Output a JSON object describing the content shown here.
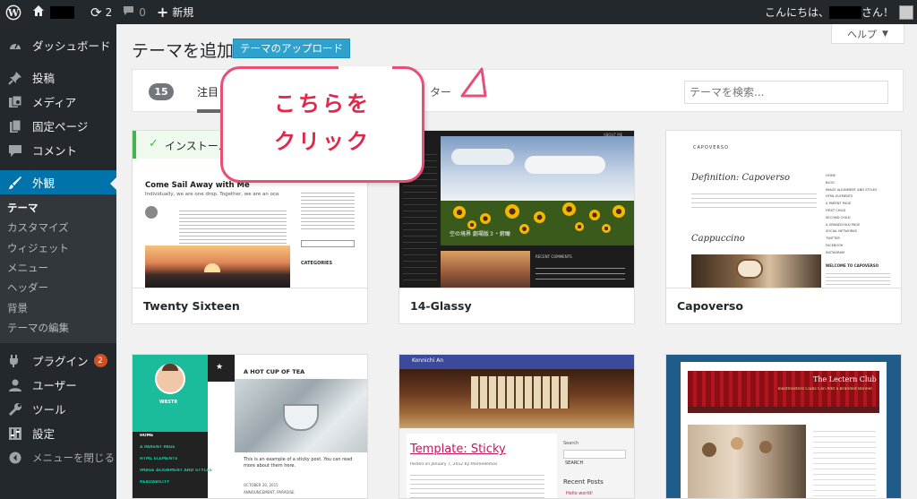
{
  "adminbar": {
    "updates_count": "2",
    "comments_count": "0",
    "new_label": "新規",
    "greeting_prefix": "こんにちは、",
    "greeting_suffix": "さん！"
  },
  "sidebar": {
    "items": [
      {
        "label": "ダッシュボード",
        "icon": "dashboard-icon"
      },
      {
        "label": "投稿",
        "icon": "pin-icon"
      },
      {
        "label": "メディア",
        "icon": "media-icon"
      },
      {
        "label": "固定ページ",
        "icon": "pages-icon"
      },
      {
        "label": "コメント",
        "icon": "comment-icon"
      },
      {
        "label": "外観",
        "icon": "brush-icon"
      },
      {
        "label": "プラグイン",
        "icon": "plugin-icon",
        "badge": "2"
      },
      {
        "label": "ユーザー",
        "icon": "user-icon"
      },
      {
        "label": "ツール",
        "icon": "wrench-icon"
      },
      {
        "label": "設定",
        "icon": "settings-icon"
      },
      {
        "label": "メニューを閉じる",
        "icon": "collapse-icon"
      }
    ],
    "submenu": [
      "テーマ",
      "カスタマイズ",
      "ウィジェット",
      "メニュー",
      "ヘッダー",
      "背景",
      "テーマの編集"
    ]
  },
  "main": {
    "title": "テーマを追加",
    "upload_label": "テーマのアップロード",
    "help_label": "ヘルプ",
    "help_arrow": "▼",
    "count": "15",
    "filter_popular": "注目",
    "filter_tail": "ター",
    "search_placeholder": "テーマを検索..."
  },
  "callout": {
    "line1": "こちらを",
    "line2": "クリック"
  },
  "themes": [
    {
      "name": "Twenty Sixteen",
      "installed_label": "インストール済",
      "post_title": "Come Sail Away with Me",
      "post_subtitle": "Individually, we are one drop. Together, we are an ocean.",
      "sidebar_heading": "CATEGORIES"
    },
    {
      "name": "14-Glassy",
      "hero_caption": "空の境界 劇場版３・俯瞰",
      "recent_comments": "RECENT COMMENTS",
      "about_label": "ABOUT ME"
    },
    {
      "name": "Capoverso",
      "logo": "CAPOVERSO",
      "post1_title": "Definition: Capoverso",
      "post2_title": "Cappuccino",
      "welcome": "WELCOME TO CAPOVERSO",
      "menu": [
        "HOME",
        "BLOG",
        "IMAGE ALIGNMENT AND STYLES",
        "HTML ELEMENTS",
        "A PARENT PAGE",
        "FIRST CHILD",
        "SECOND CHILD",
        "A GRANDCHILD PAGE",
        "SOCIAL NETWORKS",
        "TWITTER",
        "FACEBOOK",
        "INSTAGRAM"
      ]
    },
    {
      "name": "",
      "profile_name": "WBSTR",
      "post_title": "A HOT CUP OF TEA",
      "nav": [
        "HOME",
        "A PARENT PAGE",
        "HTML ELEMENTS",
        "IMAGE ALIGNMENT AND STYLES",
        "READABILITY"
      ],
      "excerpt": "This is an example of a sticky post. You can read more about them here.",
      "date": "OCTOBER 20, 2015",
      "tag": "ANNOUNCEMENT, PARADISE"
    },
    {
      "name": "",
      "site_title": "Konnichi An",
      "post_title": "Template: Sticky",
      "meta": "Posted on January 7, 2012 by themedemos",
      "search_label": "Search",
      "search_button": "SEARCH",
      "recent_posts": "Recent Posts",
      "recent_item": "Hello world!"
    },
    {
      "name": "",
      "site_title": "The Lectern Club",
      "tagline": "Toastmasters Clubs Can Add a Branded Banner"
    }
  ]
}
